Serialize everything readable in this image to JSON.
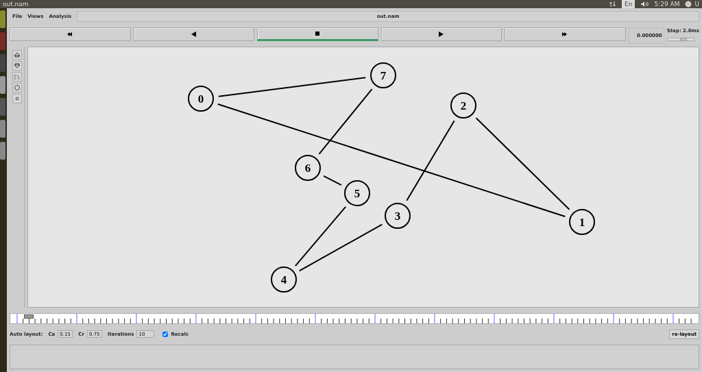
{
  "top_bar": {
    "app_title": "out.nam",
    "keyboard": "En",
    "clock": "5:29 AM",
    "user": "U"
  },
  "menu": [
    "File",
    "Views",
    "Analysis"
  ],
  "window_title": "out.nam",
  "transport": [
    {
      "kind": "rewind",
      "selected": false
    },
    {
      "kind": "back",
      "selected": false
    },
    {
      "kind": "stop",
      "selected": true
    },
    {
      "kind": "play",
      "selected": false
    },
    {
      "kind": "forward",
      "selected": false
    }
  ],
  "time": "0.000000",
  "step": {
    "label": "Step: 2.0ms",
    "level": 0.6
  },
  "timeline": {
    "level": 0.02
  },
  "tools": [
    {
      "kind": "zoom-in"
    },
    {
      "kind": "zoom-out"
    },
    {
      "kind": "text"
    },
    {
      "kind": "circle"
    },
    {
      "kind": "dot"
    }
  ],
  "nodes": [
    {
      "label": "0"
    },
    {
      "label": "7"
    },
    {
      "label": "2"
    },
    {
      "label": "6"
    },
    {
      "label": "5"
    },
    {
      "label": "3"
    },
    {
      "label": "1"
    },
    {
      "label": "4"
    }
  ],
  "auto_layout": {
    "label": "Auto layout:",
    "ca_label": "Ca",
    "ca": "0.15",
    "cr_label": "Cr",
    "cr": "0.75",
    "iterations_label": "Iterations",
    "iterations": "10",
    "recalc": {
      "label": "Recalc",
      "checked": true
    },
    "button": "re-layout"
  }
}
